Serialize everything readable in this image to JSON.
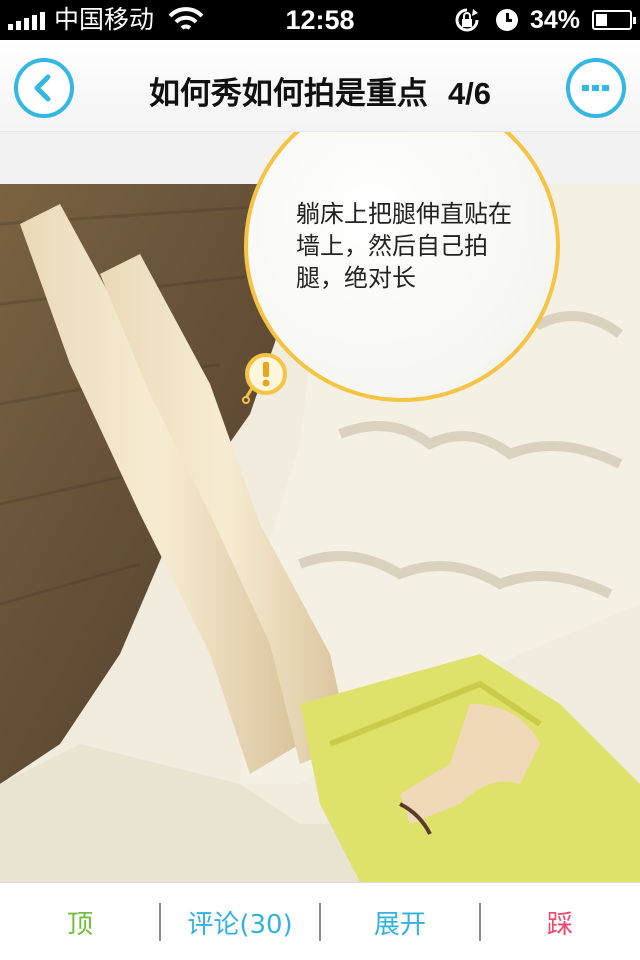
{
  "status_bar": {
    "carrier": "中国移动",
    "time": "12:58",
    "battery_percent": "34%",
    "battery_level": 0.34,
    "signal_bars": 5
  },
  "nav": {
    "title": "如何秀如何拍是重点",
    "page_counter": "4/6",
    "back_icon": "chevron-left-icon",
    "more_icon": "more-dots-icon"
  },
  "annotation": {
    "text": "躺床上把腿伸直贴在墙上，然后自己拍腿，绝对长",
    "icon": "exclamation-pin-icon"
  },
  "bottom_bar": {
    "up_label": "顶",
    "comment_label": "评论(30)",
    "expand_label": "展开",
    "down_label": "踩"
  },
  "colors": {
    "accent": "#33b7e3",
    "bubble_border": "#f6c343",
    "up": "#6fbf3f",
    "down": "#f0476a"
  }
}
